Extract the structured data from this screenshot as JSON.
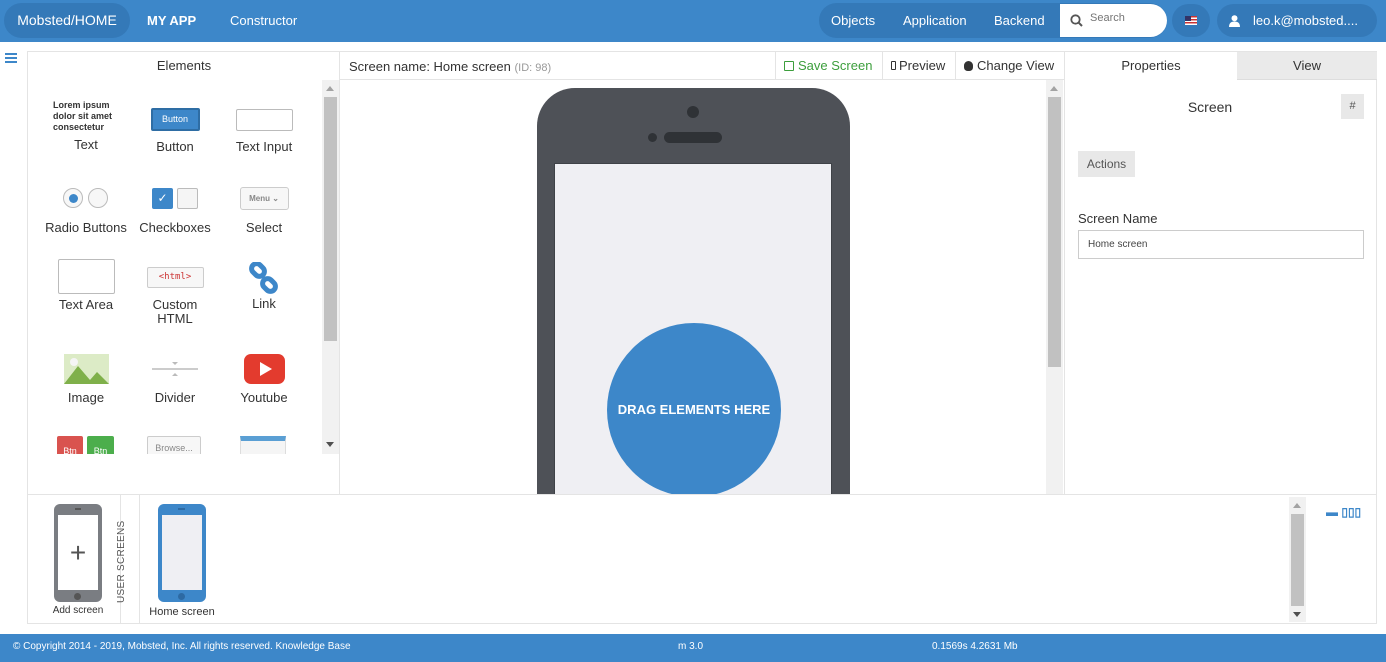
{
  "nav": {
    "brand": "Mobsted/HOME",
    "app": "MY APP",
    "constructor": "Constructor",
    "links": [
      "Objects",
      "Application",
      "Backend"
    ],
    "search_placeholder": "Search",
    "user": "leo.k@mobsted...."
  },
  "elements": {
    "title": "Elements",
    "items": [
      {
        "label": "Text",
        "icon": "lorem-text-icon"
      },
      {
        "label": "Button",
        "icon": "button-icon"
      },
      {
        "label": "Text Input",
        "icon": "text-input-icon"
      },
      {
        "label": "Radio Buttons",
        "icon": "radio-buttons-icon"
      },
      {
        "label": "Checkboxes",
        "icon": "checkboxes-icon"
      },
      {
        "label": "Select",
        "icon": "select-icon"
      },
      {
        "label": "Text Area",
        "icon": "text-area-icon"
      },
      {
        "label": "Custom HTML",
        "icon": "html-icon"
      },
      {
        "label": "Link",
        "icon": "link-icon"
      },
      {
        "label": "Image",
        "icon": "image-icon"
      },
      {
        "label": "Divider",
        "icon": "divider-icon"
      },
      {
        "label": "Youtube",
        "icon": "youtube-icon"
      }
    ],
    "lorem": [
      "Lorem ipsum",
      "dolor sit amet",
      "consectetur"
    ],
    "button_preview": "Button",
    "select_preview": "Menu",
    "html_preview": "<html>",
    "btn_preview": "Btn",
    "browse_preview": "Browse..."
  },
  "canvas": {
    "screen_name_label": "Screen name: Home screen",
    "screen_id": "(ID: 98)",
    "save": "Save Screen",
    "preview": "Preview",
    "change_view": "Change View",
    "dropzone": "DRAG ELEMENTS HERE"
  },
  "properties": {
    "tabs": [
      "Properties",
      "View"
    ],
    "title": "Screen",
    "hash": "#",
    "actions": "Actions",
    "field_label": "Screen Name",
    "field_value": "Home screen"
  },
  "screens": {
    "add": "Add screen",
    "side_label": "USER SCREENS",
    "items": [
      "Home screen"
    ],
    "controls": "▬ ▯▯▯"
  },
  "footer": {
    "copyright": "© Copyright 2014 - 2019, Mobsted, Inc. All rights reserved.  Knowledge Base",
    "version": "m 3.0",
    "stats": "0.1569s 4.2631 Mb"
  },
  "colors": {
    "accent": "#3d87c9",
    "save": "#3c9e3c",
    "youtube": "#e33b2e"
  }
}
